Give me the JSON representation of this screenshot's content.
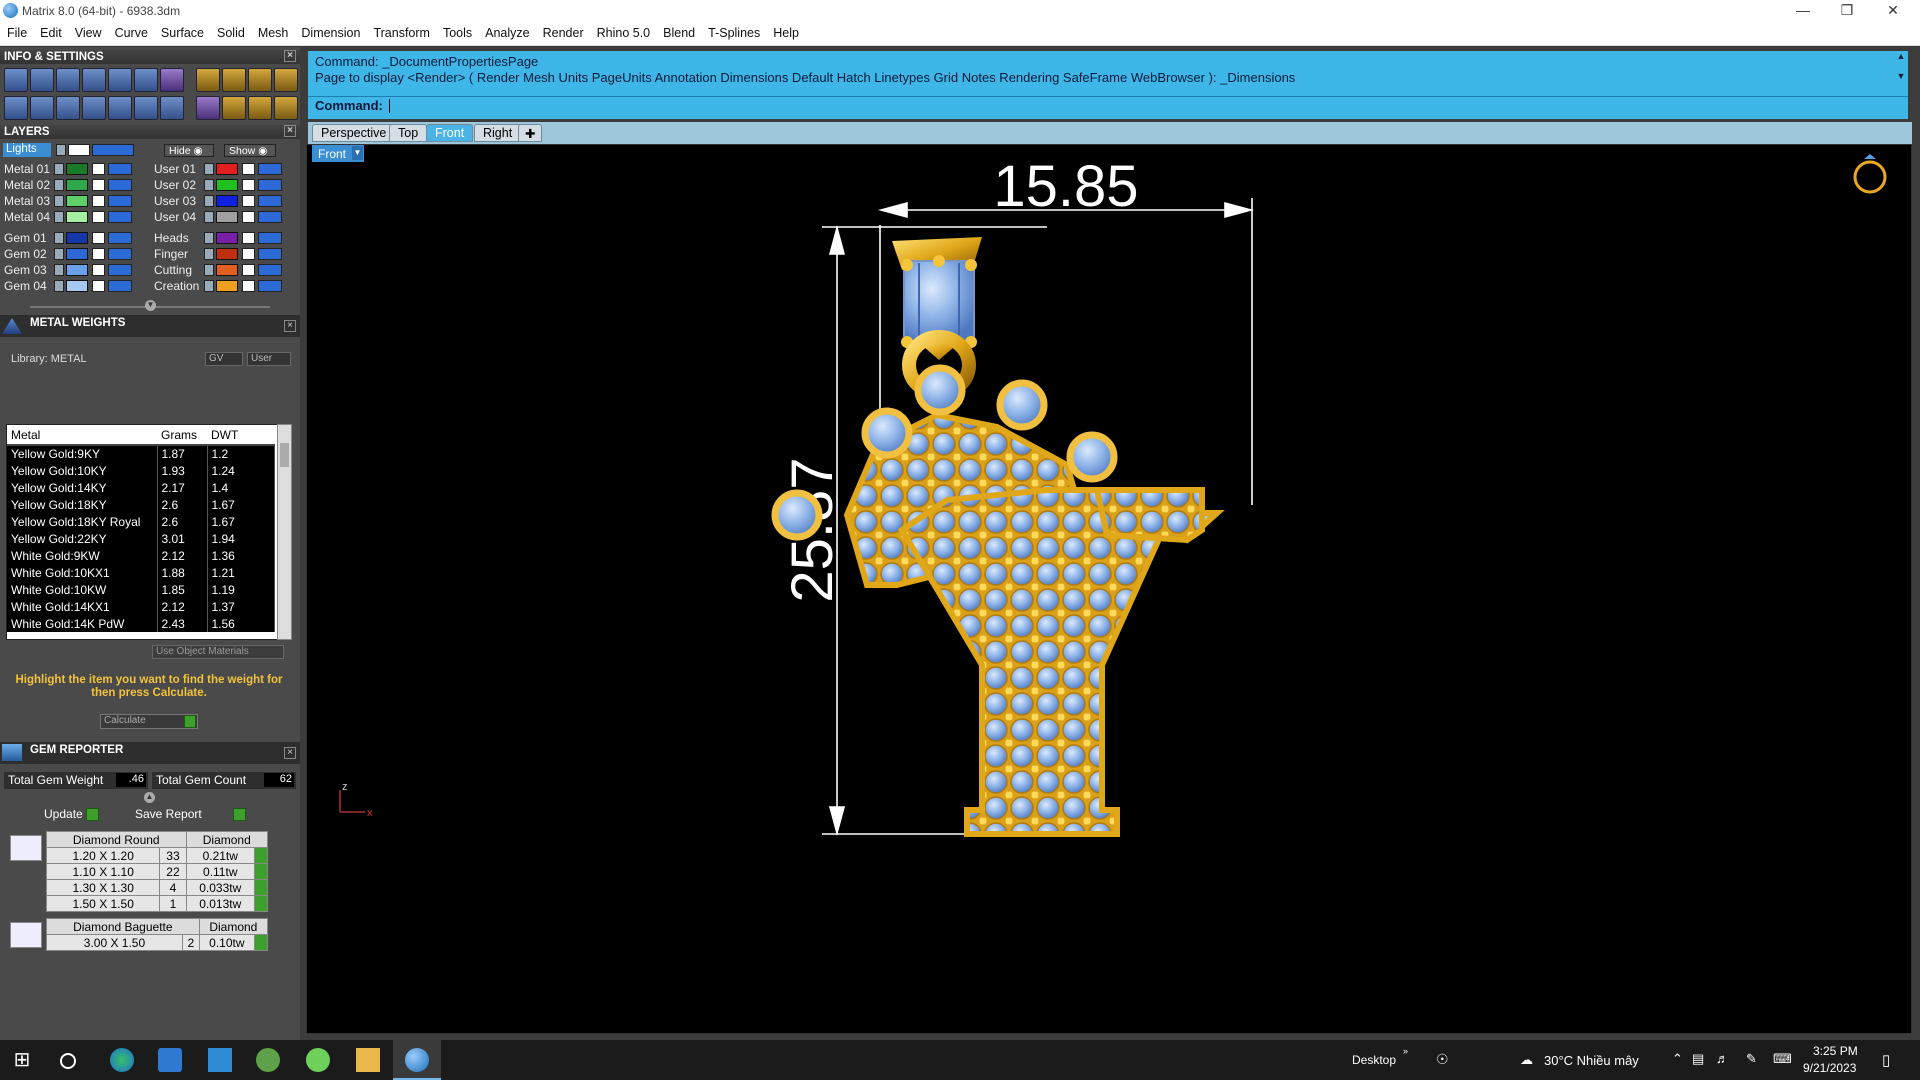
{
  "app": {
    "title": "Matrix 8.0 (64-bit) - 6938.3dm",
    "window_controls": [
      "minimize-icon",
      "restore-icon",
      "close-icon"
    ]
  },
  "menu": [
    "File",
    "Edit",
    "View",
    "Curve",
    "Surface",
    "Solid",
    "Mesh",
    "Dimension",
    "Transform",
    "Tools",
    "Analyze",
    "Render",
    "Rhino 5.0",
    "Blend",
    "T-Splines",
    "Help"
  ],
  "info_settings": {
    "title": "INFO & SETTINGS"
  },
  "layers": {
    "title": "LAYERS",
    "lights_label": "Lights",
    "hide_label": "Hide",
    "show_label": "Show",
    "left": [
      {
        "name": "Metal 01",
        "color": "#1a7a2a"
      },
      {
        "name": "Metal 02",
        "color": "#2ea84a"
      },
      {
        "name": "Metal 03",
        "color": "#5ed06a"
      },
      {
        "name": "Metal 04",
        "color": "#a4f0a0"
      },
      {
        "name": "Gem 01",
        "color": "#1438a8"
      },
      {
        "name": "Gem 02",
        "color": "#2e68d8"
      },
      {
        "name": "Gem 03",
        "color": "#6aa0ec"
      },
      {
        "name": "Gem 04",
        "color": "#a8c8f4"
      }
    ],
    "right": [
      {
        "name": "User 01",
        "color": "#e02020"
      },
      {
        "name": "User 02",
        "color": "#20c020"
      },
      {
        "name": "User 03",
        "color": "#1020e0"
      },
      {
        "name": "User 04",
        "color": "#a0a0a0"
      },
      {
        "name": "Heads",
        "color": "#7a20a8"
      },
      {
        "name": "Finger",
        "color": "#c03010"
      },
      {
        "name": "Cutting",
        "color": "#e06020"
      },
      {
        "name": "Creation",
        "color": "#f0a020"
      }
    ]
  },
  "metal_weights": {
    "title": "METAL WEIGHTS",
    "library": "Library: METAL",
    "gv_label": "GV",
    "user_label": "User",
    "columns": [
      "Metal",
      "Grams",
      "DWT"
    ],
    "rows": [
      [
        "Yellow Gold:9KY",
        "1.87",
        "1.2"
      ],
      [
        "Yellow Gold:10KY",
        "1.93",
        "1.24"
      ],
      [
        "Yellow Gold:14KY",
        "2.17",
        "1.4"
      ],
      [
        "Yellow Gold:18KY",
        "2.6",
        "1.67"
      ],
      [
        "Yellow Gold:18KY Royal",
        "2.6",
        "1.67"
      ],
      [
        "Yellow Gold:22KY",
        "3.01",
        "1.94"
      ],
      [
        "White Gold:9KW",
        "2.12",
        "1.36"
      ],
      [
        "White Gold:10KX1",
        "1.88",
        "1.21"
      ],
      [
        "White Gold:10KW",
        "1.85",
        "1.19"
      ],
      [
        "White Gold:14KX1",
        "2.12",
        "1.37"
      ],
      [
        "White Gold:14K PdW",
        "2.43",
        "1.56"
      ]
    ],
    "use_object_materials": "Use Object Materials",
    "hint": "Highlight the item you want to find the weight for then press Calculate.",
    "calculate": "Calculate"
  },
  "gem_reporter": {
    "title": "GEM REPORTER",
    "total_weight_label": "Total Gem Weight",
    "total_weight_value": ".46",
    "total_count_label": "Total Gem Count",
    "total_count_value": "62",
    "update": "Update",
    "save_report": "Save Report",
    "groups": [
      {
        "icon": "round-gem-icon",
        "header": [
          "Diamond Round",
          "Diamond"
        ],
        "rows": [
          [
            "1.20 X 1.20",
            "33",
            "0.21tw"
          ],
          [
            "1.10 X 1.10",
            "22",
            "0.11tw"
          ],
          [
            "1.30 X 1.30",
            "4",
            "0.033tw"
          ],
          [
            "1.50 X 1.50",
            "1",
            "0.013tw"
          ]
        ]
      },
      {
        "icon": "baguette-gem-icon",
        "header": [
          "Diamond Baguette",
          "Diamond"
        ],
        "rows": [
          [
            "3.00 X 1.50",
            "2",
            "0.10tw"
          ]
        ]
      }
    ]
  },
  "command": {
    "line1": "Command: _DocumentPropertiesPage",
    "line2": "Page to display <Render> ( Render  Mesh  Units  PageUnits  Annotation  Dimensions  Default  Hatch  Linetypes  Grid  Notes  Rendering  SafeFrame  WebBrowser ): _Dimensions",
    "prompt": "Command:"
  },
  "viewport": {
    "tabs": [
      "Perspective",
      "Top",
      "Front",
      "Right"
    ],
    "active_tab": "Front",
    "label": "Front",
    "dim_width": "15.85",
    "dim_height": "25.87",
    "axis_z": "z",
    "axis_x": "x"
  },
  "taskbar": {
    "desktop": "Desktop",
    "weather": "30°C  Nhiều mây",
    "time": "3:25 PM",
    "date": "9/21/2023"
  }
}
